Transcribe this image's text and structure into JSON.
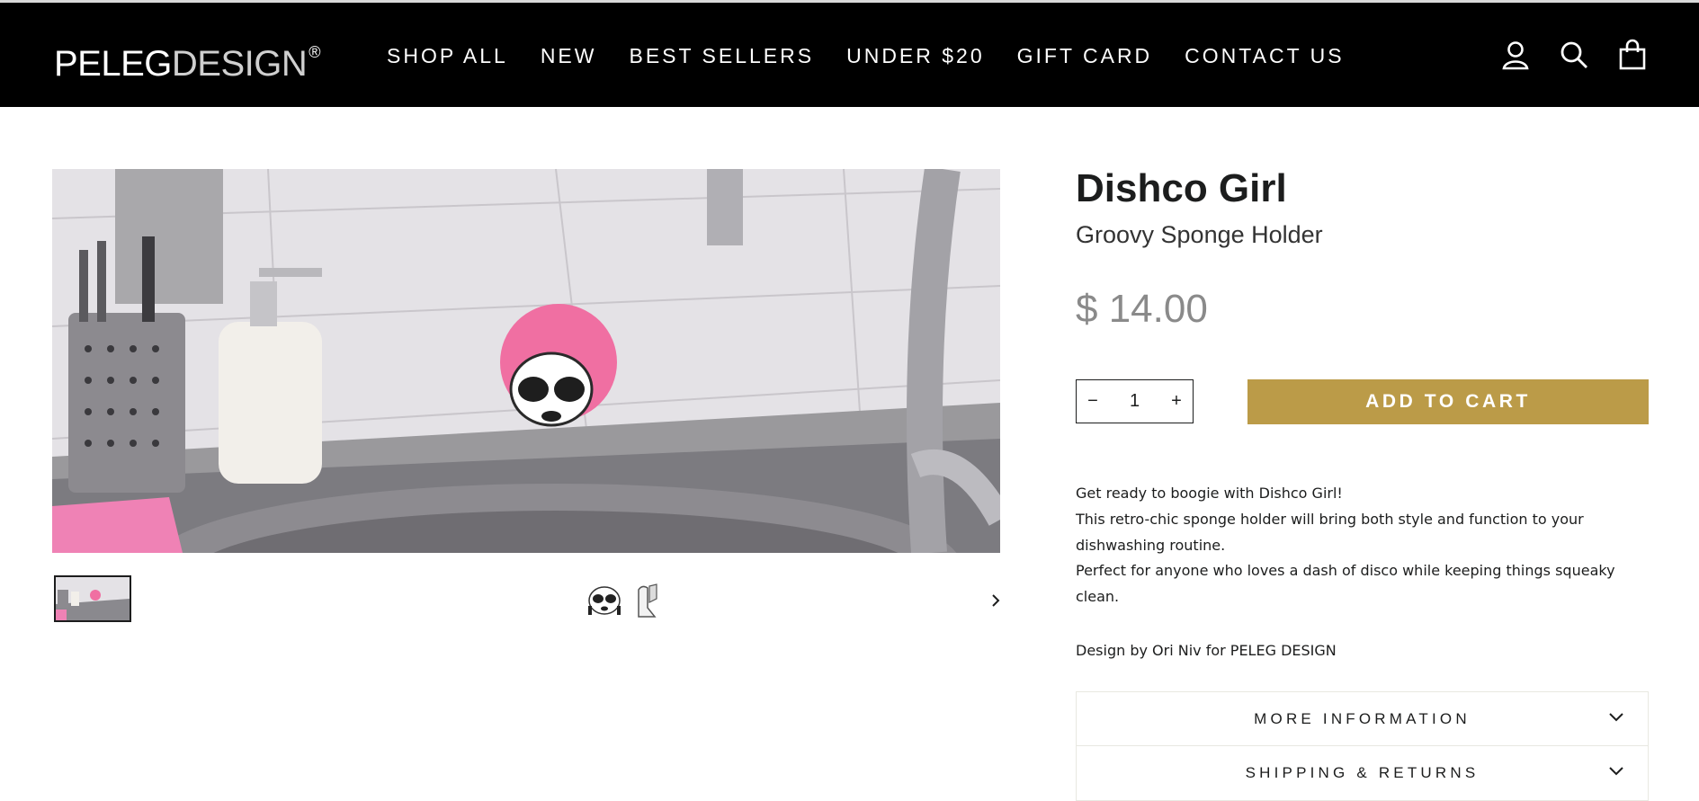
{
  "header": {
    "logo": {
      "part1": "PELEG",
      "part2": "DESIGN",
      "mark": "®"
    },
    "nav": [
      "SHOP ALL",
      "NEW",
      "BEST SELLERS",
      "UNDER $20",
      "GIFT CARD",
      "CONTACT US"
    ],
    "icons": [
      "account-icon",
      "search-icon",
      "cart-icon"
    ]
  },
  "gallery": {
    "thumbnails": [
      "kitchen-scene-thumbnail",
      "dishco-girl-face-thumbnail",
      "sponge-holder-side-thumbnail"
    ],
    "next_icon": "chevron-right-icon"
  },
  "product": {
    "title": "Dishco Girl",
    "subtitle": "Groovy Sponge Holder",
    "price": "$ 14.00",
    "quantity": "1",
    "qty_minus": "−",
    "qty_plus": "+",
    "add_to_cart": "ADD TO CART",
    "description": [
      "Get ready to boogie with Dishco Girl!",
      "This retro-chic sponge holder will bring both style and function to your dishwashing routine.",
      "Perfect for anyone who loves a dash of disco while keeping things squeaky clean."
    ],
    "designer": "Design by Ori Niv for PELEG DESIGN",
    "accordion": [
      "MORE INFORMATION",
      "SHIPPING & RETURNS"
    ]
  },
  "colors": {
    "header_bg": "#000000",
    "accent": "#bb9b48",
    "price": "#8a8a8a",
    "sponge_pink": "#f06fa2"
  }
}
